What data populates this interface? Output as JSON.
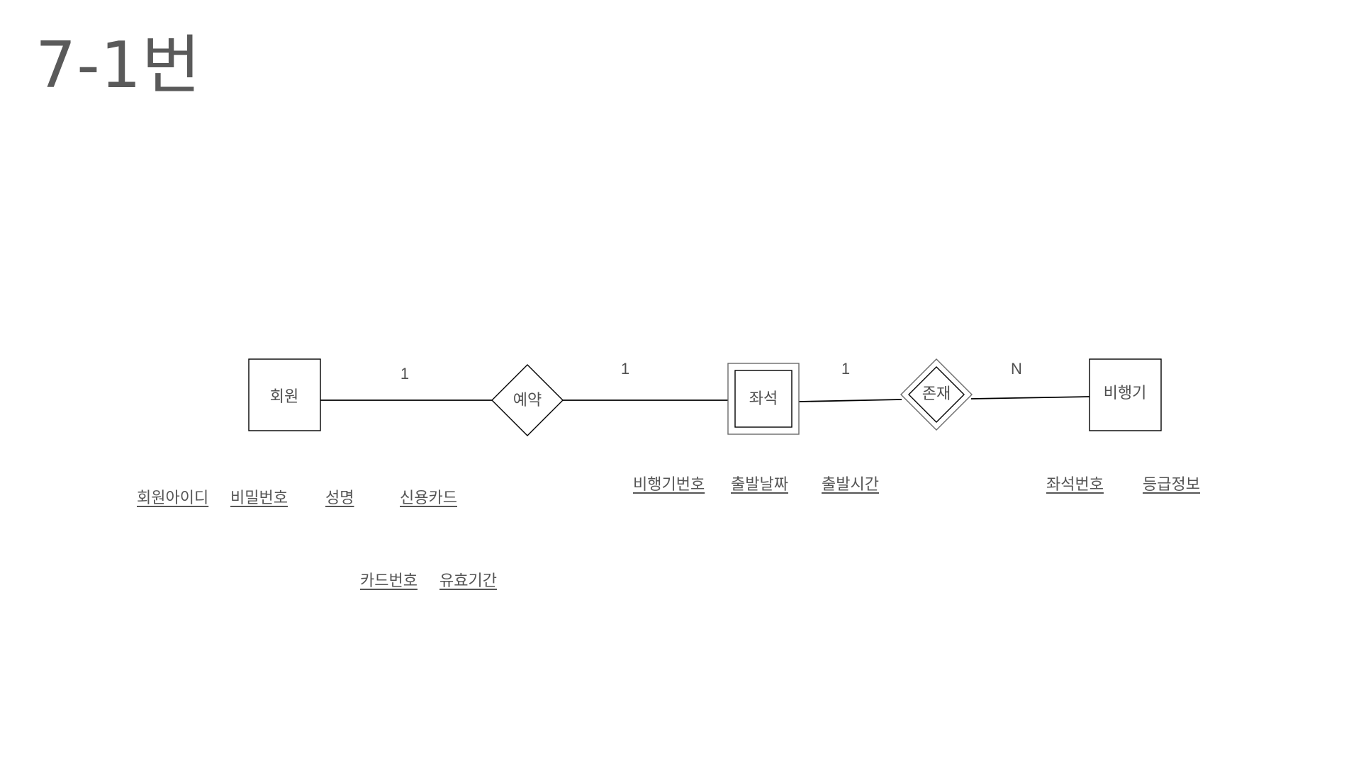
{
  "title": "7-1번",
  "entities": {
    "member": "회원",
    "seat": "좌석",
    "airplane": "비행기"
  },
  "relationships": {
    "reservation": "예약",
    "existence": "존재"
  },
  "cardinalities": {
    "member_reservation": "1",
    "reservation_seat": "1",
    "seat_existence": "1",
    "existence_airplane": "N"
  },
  "attributes": {
    "member": [
      "회원아이디",
      "비밀번호",
      "성명",
      "신용카드"
    ],
    "credit_card": [
      "카드번호",
      "유효기간"
    ],
    "seat": [
      "비행기번호",
      "출발날짜",
      "출발시간"
    ],
    "airplane": [
      "좌석번호",
      "등급정보"
    ]
  }
}
